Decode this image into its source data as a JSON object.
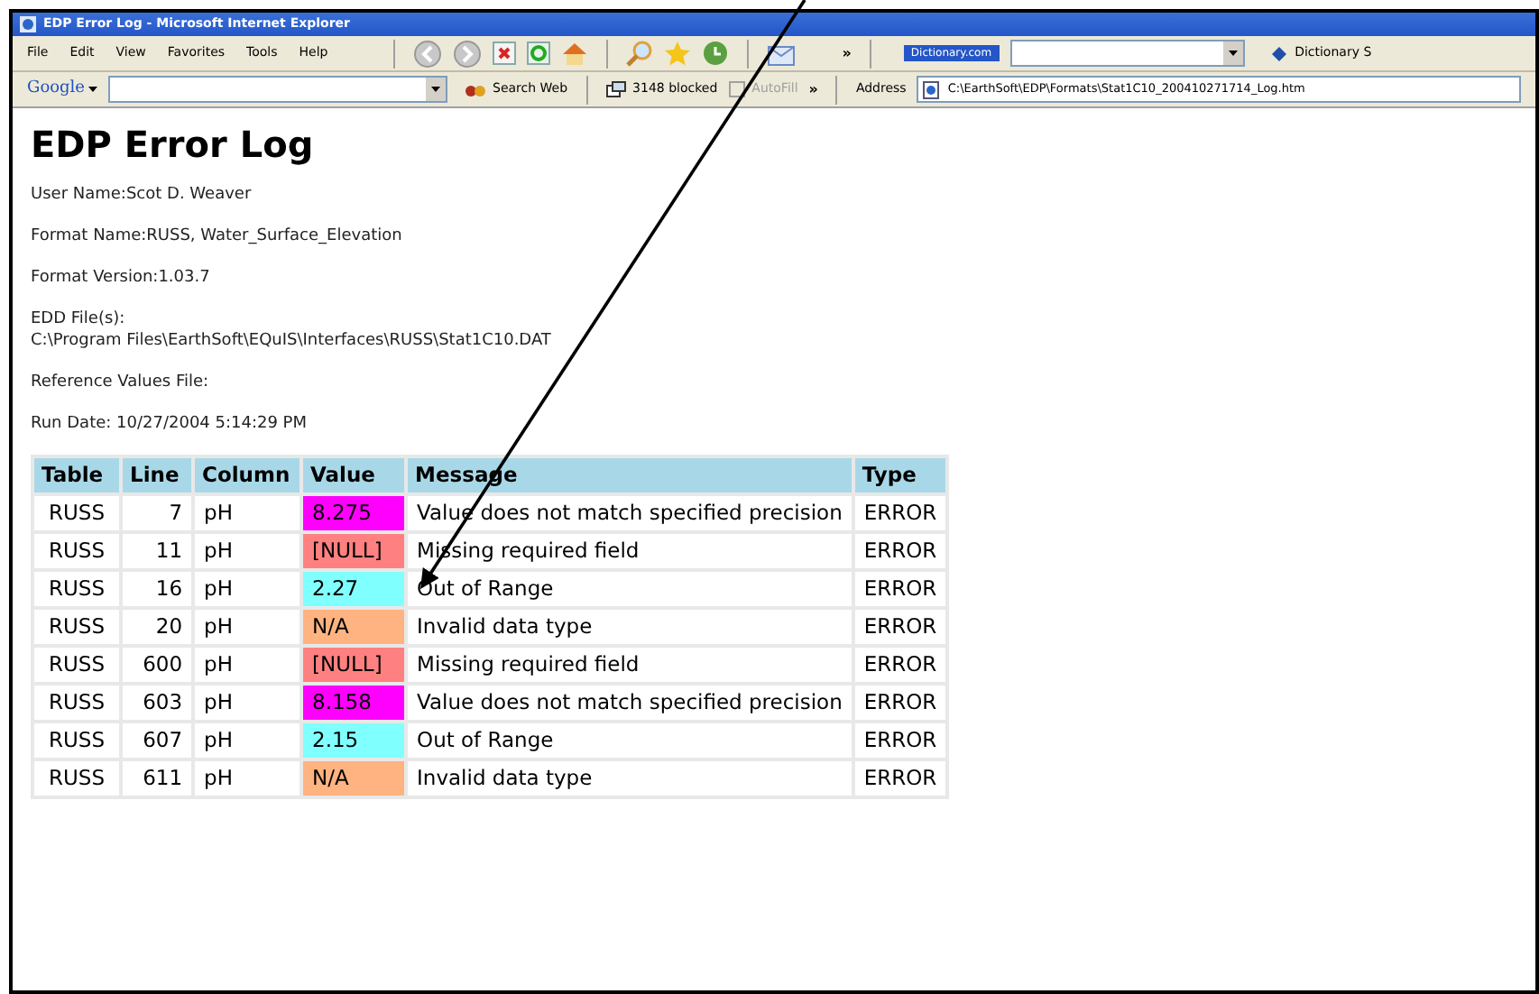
{
  "window": {
    "title": "EDP Error Log - Microsoft Internet Explorer"
  },
  "menu": [
    "File",
    "Edit",
    "View",
    "Favorites",
    "Tools",
    "Help"
  ],
  "toolbar": {
    "more": "»",
    "dictionary_label": "Dictionary.com",
    "dictionary_button": "Dictionary S"
  },
  "google_bar": {
    "logo": "Google",
    "search_web": "Search Web",
    "blocked": "3148 blocked",
    "autofill": "AutoFill",
    "more": "»",
    "address_label": "Address",
    "address": "C:\\EarthSoft\\EDP\\Formats\\Stat1C10_200410271714_Log.htm"
  },
  "page": {
    "heading": "EDP Error Log",
    "fields": [
      {
        "text": "User Name:Scot D. Weaver"
      },
      {
        "text": "Format Name:RUSS, Water_Surface_Elevation"
      },
      {
        "text": "Format Version:1.03.7"
      },
      {
        "text": "EDD File(s):",
        "value": "C:\\Program Files\\EarthSoft\\EQuIS\\Interfaces\\RUSS\\Stat1C10.DAT"
      },
      {
        "text": "Reference Values File:"
      },
      {
        "text": "Run Date: 10/27/2004 5:14:29 PM"
      }
    ]
  },
  "table": {
    "columns": [
      "Table",
      "Line",
      "Column",
      "Value",
      "Message",
      "Type"
    ],
    "rows": [
      {
        "table": "RUSS",
        "line": "7",
        "column": "pH",
        "value": "8.275",
        "color": "#ff00ff",
        "message": "Value does not match specified precision",
        "type": "ERROR"
      },
      {
        "table": "RUSS",
        "line": "11",
        "column": "pH",
        "value": "[NULL]",
        "color": "#ff8080",
        "message": "Missing required field",
        "type": "ERROR"
      },
      {
        "table": "RUSS",
        "line": "16",
        "column": "pH",
        "value": "2.27",
        "color": "#80ffff",
        "message": "Out of Range",
        "type": "ERROR"
      },
      {
        "table": "RUSS",
        "line": "20",
        "column": "pH",
        "value": "N/A",
        "color": "#ffb380",
        "message": "Invalid data type",
        "type": "ERROR"
      },
      {
        "table": "RUSS",
        "line": "600",
        "column": "pH",
        "value": "[NULL]",
        "color": "#ff8080",
        "message": "Missing required field",
        "type": "ERROR"
      },
      {
        "table": "RUSS",
        "line": "603",
        "column": "pH",
        "value": "8.158",
        "color": "#ff00ff",
        "message": "Value does not match specified precision",
        "type": "ERROR"
      },
      {
        "table": "RUSS",
        "line": "607",
        "column": "pH",
        "value": "2.15",
        "color": "#80ffff",
        "message": "Out of Range",
        "type": "ERROR"
      },
      {
        "table": "RUSS",
        "line": "611",
        "column": "pH",
        "value": "N/A",
        "color": "#ffb380",
        "message": "Invalid data type",
        "type": "ERROR"
      }
    ]
  }
}
